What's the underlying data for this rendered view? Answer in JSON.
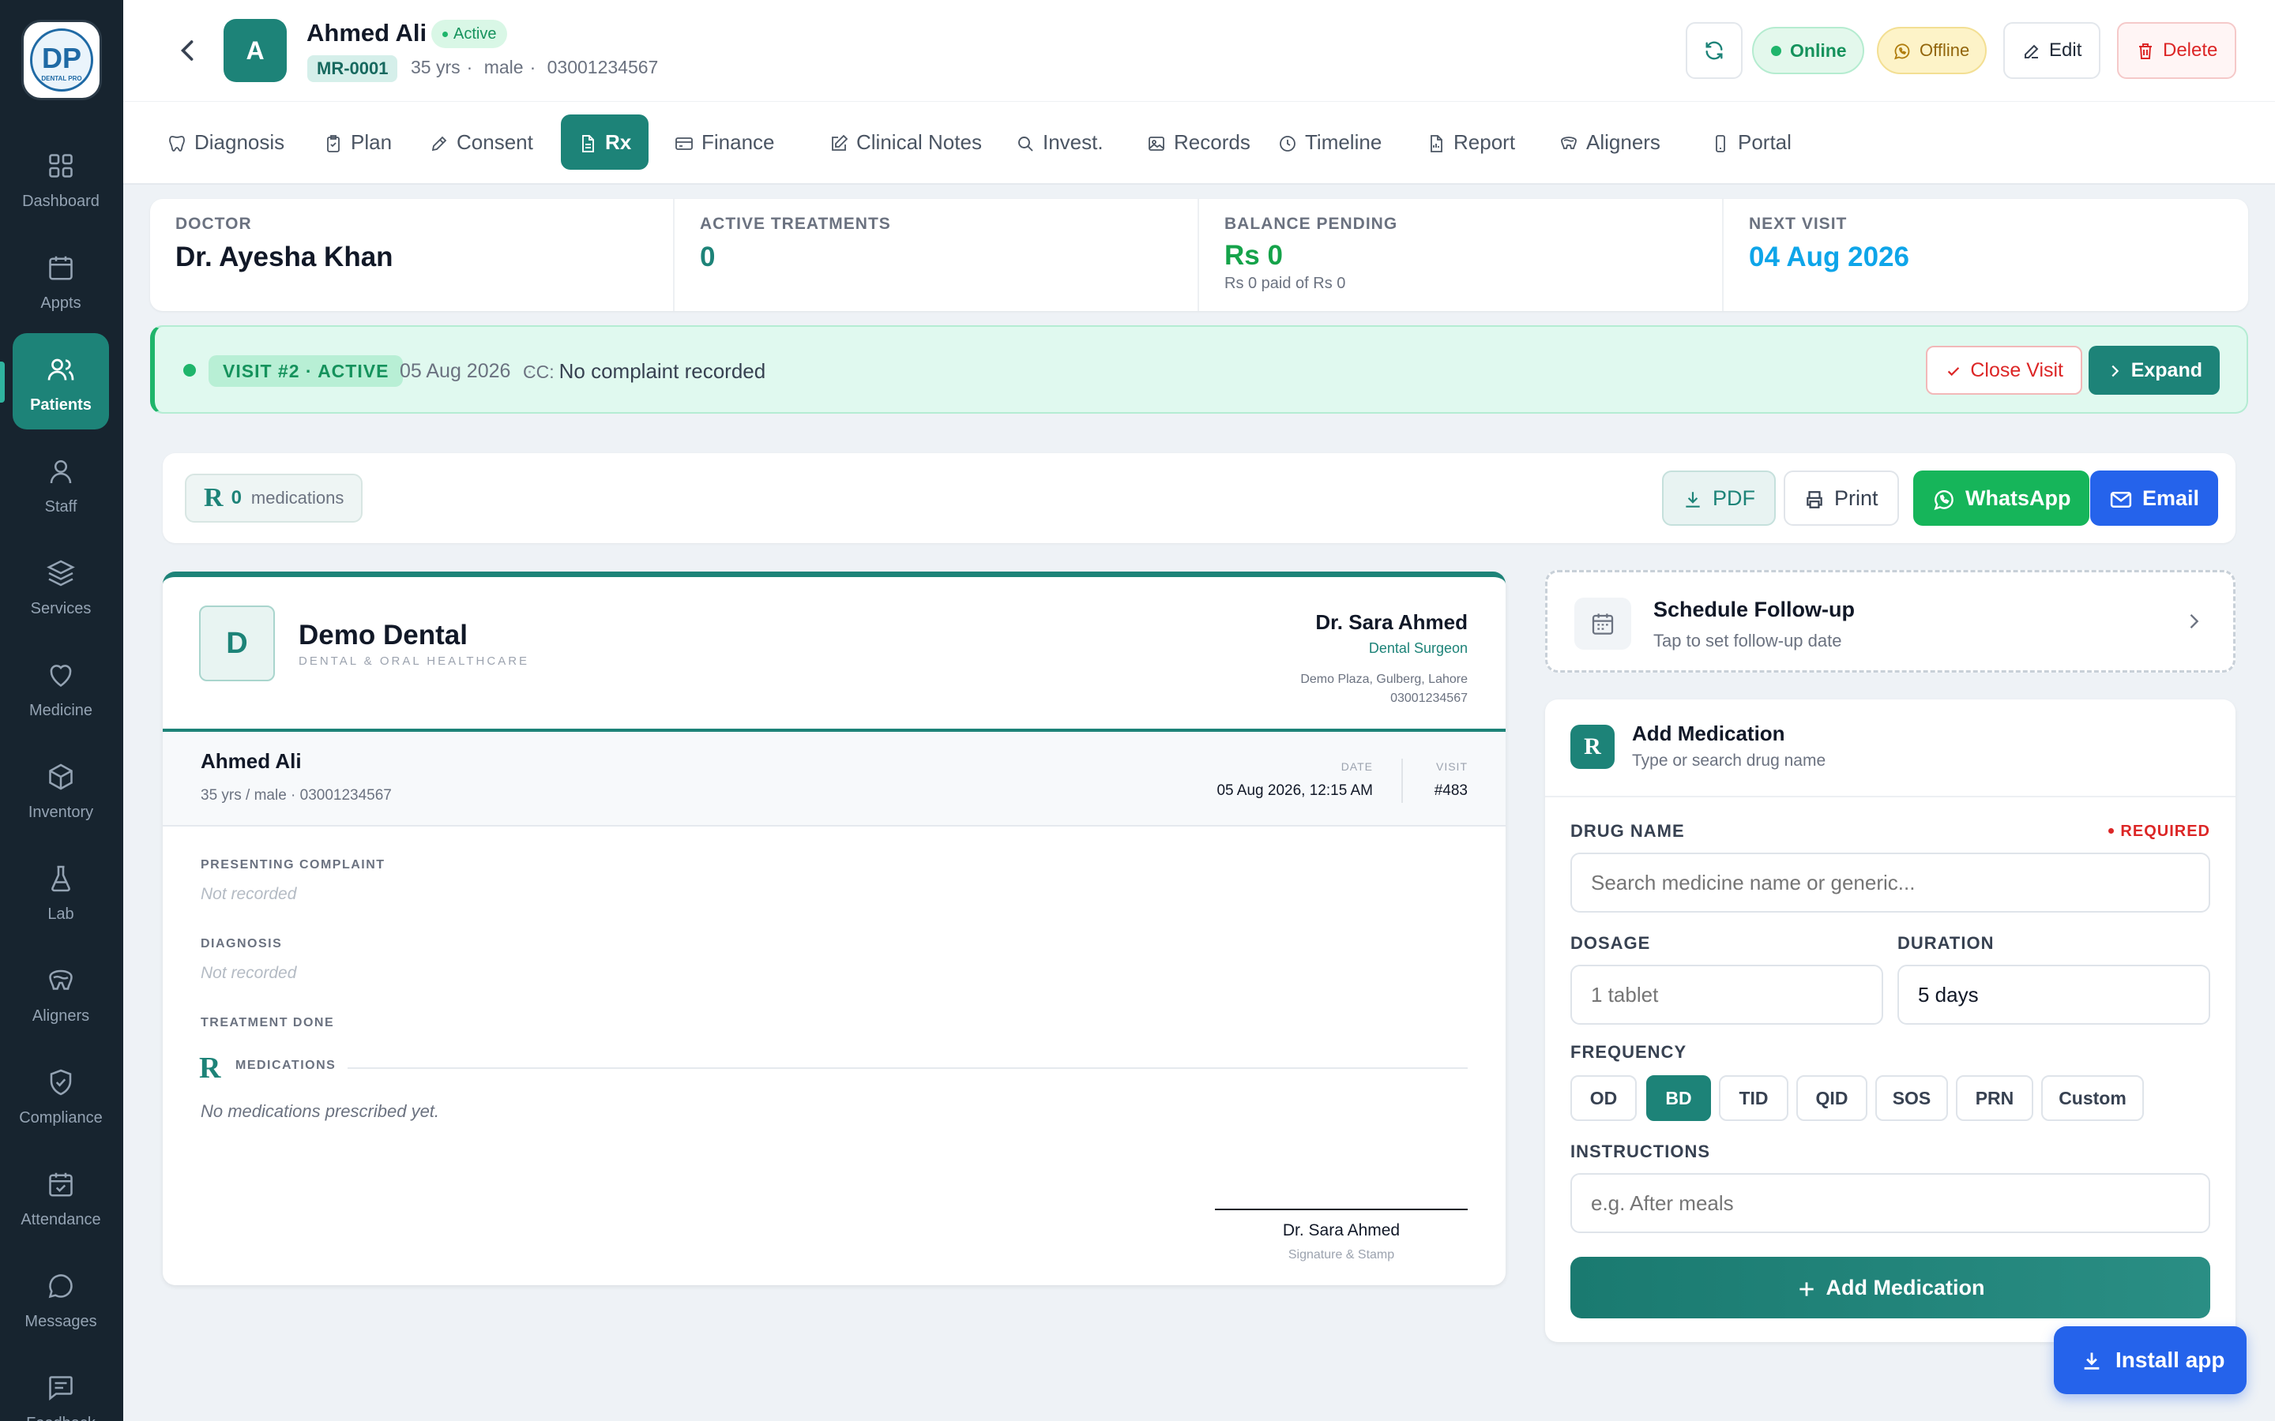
{
  "sidebar": {
    "logo_text": "DP",
    "logo_caption": "DENTAL PRO",
    "items": [
      {
        "label": "Dashboard",
        "icon": "dashboard-icon"
      },
      {
        "label": "Appts",
        "icon": "calendar-icon"
      },
      {
        "label": "Patients",
        "icon": "users-icon",
        "active": true
      },
      {
        "label": "Staff",
        "icon": "user-icon"
      },
      {
        "label": "Services",
        "icon": "layers-icon"
      },
      {
        "label": "Medicine",
        "icon": "heart-icon"
      },
      {
        "label": "Inventory",
        "icon": "box-icon"
      },
      {
        "label": "Lab",
        "icon": "flask-icon"
      },
      {
        "label": "Aligners",
        "icon": "tooth-icon"
      },
      {
        "label": "Compliance",
        "icon": "shield-icon"
      },
      {
        "label": "Attendance",
        "icon": "calendar-check-icon"
      },
      {
        "label": "Messages",
        "icon": "message-icon"
      },
      {
        "label": "Feedback",
        "icon": "feedback-icon"
      }
    ]
  },
  "patient": {
    "initial": "A",
    "name": "Ahmed Ali",
    "status": "Active",
    "mrn": "MR-0001",
    "age": "35 yrs",
    "gender": "male",
    "phone": "03001234567"
  },
  "header_actions": {
    "online": "Online",
    "offline": "Offline",
    "edit": "Edit",
    "delete": "Delete"
  },
  "tabs": [
    {
      "label": "Diagnosis",
      "icon": "tooth-icon"
    },
    {
      "label": "Plan",
      "icon": "clipboard-icon"
    },
    {
      "label": "Consent",
      "icon": "pen-icon"
    },
    {
      "label": "Rx",
      "icon": "file-icon",
      "active": true
    },
    {
      "label": "Finance",
      "icon": "card-icon"
    },
    {
      "label": "Clinical Notes",
      "icon": "edit-icon"
    },
    {
      "label": "Invest.",
      "icon": "search-icon"
    },
    {
      "label": "Records",
      "icon": "image-icon"
    },
    {
      "label": "Timeline",
      "icon": "clock-icon"
    },
    {
      "label": "Report",
      "icon": "report-icon"
    },
    {
      "label": "Aligners",
      "icon": "aligner-icon"
    },
    {
      "label": "Portal",
      "icon": "phone-icon"
    }
  ],
  "stats": [
    {
      "label": "DOCTOR",
      "value": "Dr. Ayesha Khan",
      "sub": "",
      "color": "#111827"
    },
    {
      "label": "ACTIVE TREATMENTS",
      "value": "0",
      "sub": "",
      "color": "#1d8378"
    },
    {
      "label": "BALANCE PENDING",
      "value": "Rs 0",
      "sub": "Rs 0 paid of Rs 0",
      "color": "#15a34a"
    },
    {
      "label": "NEXT VISIT",
      "value": "04 Aug 2026",
      "sub": "",
      "color": "#0ea5e9"
    }
  ],
  "visit": {
    "badge": "VISIT #2 · ACTIVE",
    "date": "05 Aug 2026",
    "separator": "·",
    "cc_label": "CC:",
    "cc_value": "No complaint recorded",
    "close_label": "Close Visit",
    "expand_label": "Expand"
  },
  "rx_bar": {
    "rx_symbol": "R",
    "count": "0",
    "count_label": "medications",
    "pdf": "PDF",
    "print": "Print",
    "whatsapp": "WhatsApp",
    "email": "Email"
  },
  "prescription": {
    "clinic_initial": "D",
    "clinic_name": "Demo Dental",
    "clinic_tagline": "DENTAL & ORAL HEALTHCARE",
    "doctor_name": "Dr. Sara Ahmed",
    "doctor_role": "Dental Surgeon",
    "address": "Demo Plaza, Gulberg, Lahore",
    "clinic_phone": "03001234567",
    "patient_name": "Ahmed Ali",
    "patient_meta": "35 yrs / male · 03001234567",
    "date_label": "DATE",
    "date_value": "05 Aug 2026, 12:15 AM",
    "visit_label": "VISIT",
    "visit_value": "#483",
    "complaint_label": "PRESENTING COMPLAINT",
    "complaint_value": "Not recorded",
    "diagnosis_label": "DIAGNOSIS",
    "diagnosis_value": "Not recorded",
    "treatment_label": "TREATMENT DONE",
    "rx_symbol": "R",
    "medications_label": "MEDICATIONS",
    "no_meds": "No medications prescribed yet.",
    "signature_name": "Dr. Sara Ahmed",
    "signature_sub": "Signature & Stamp"
  },
  "followup": {
    "title": "Schedule Follow-up",
    "subtitle": "Tap to set follow-up date"
  },
  "add_medication": {
    "rx_symbol": "R",
    "title": "Add Medication",
    "subtitle": "Type or search drug name",
    "drug_label": "DRUG NAME",
    "required": "REQUIRED",
    "drug_placeholder": "Search medicine name or generic...",
    "dosage_label": "DOSAGE",
    "dosage_placeholder": "1 tablet",
    "duration_label": "DURATION",
    "duration_value": "5 days",
    "frequency_label": "FREQUENCY",
    "frequency_options": [
      "OD",
      "BD",
      "TID",
      "QID",
      "SOS",
      "PRN",
      "Custom"
    ],
    "frequency_selected": "BD",
    "instructions_label": "INSTRUCTIONS",
    "instructions_placeholder": "e.g. After meals",
    "submit": "Add Medication"
  },
  "install": {
    "label": "Install app"
  },
  "colors": {
    "primary": "#1d8378",
    "sidebar": "#17242f",
    "danger": "#dc2626",
    "whatsapp": "#16b55a",
    "email": "#2563eb"
  }
}
